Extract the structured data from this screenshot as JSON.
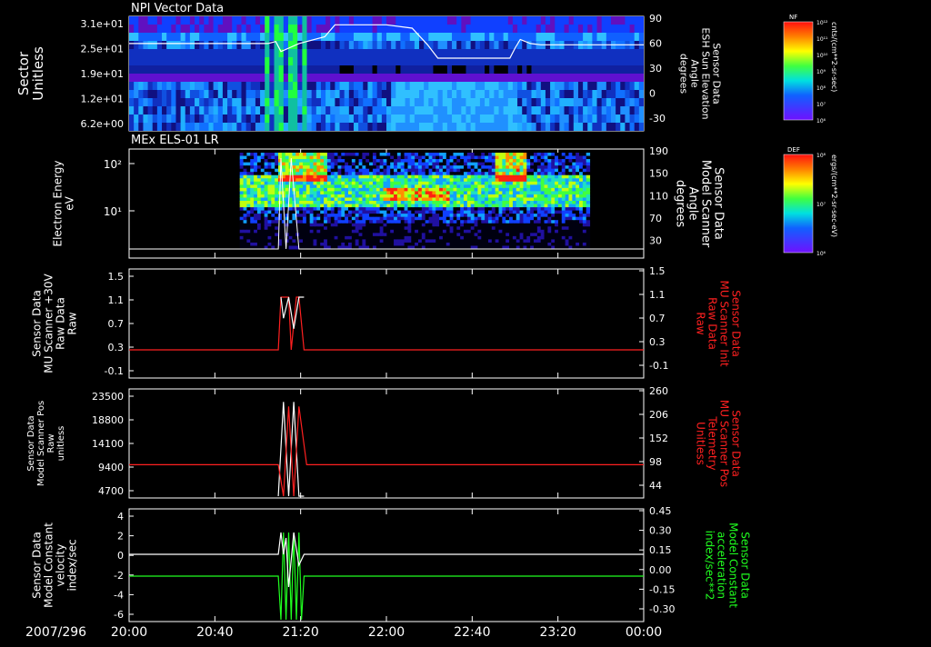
{
  "date": "2007/296",
  "time_ticks": [
    "20:00",
    "20:40",
    "21:20",
    "22:00",
    "22:40",
    "23:20",
    "00:00"
  ],
  "chart_data": [
    {
      "type": "heatmap",
      "title": "NPI Vector Data",
      "ylabel": [
        "Sector",
        "Unitless"
      ],
      "yticks": [
        "3.1e+01",
        "2.5e+01",
        "1.9e+01",
        "1.2e+01",
        "6.2e+00"
      ],
      "right_ylabel": [
        "Sensor Data",
        "ESH Sun Elevation",
        "Angle",
        "degrees"
      ],
      "right_ticks": [
        "90",
        "60",
        "30",
        "0",
        "-30"
      ],
      "right_ylim": [
        -60,
        90
      ],
      "overlay_line": {
        "x": [
          0.0,
          0.27,
          0.285,
          0.295,
          0.31,
          0.33,
          0.38,
          0.4,
          0.5,
          0.55,
          0.58,
          0.6,
          0.7,
          0.74,
          0.75,
          0.76,
          0.78,
          0.8,
          1.0
        ],
        "y": [
          52,
          52,
          55,
          40,
          45,
          52,
          62,
          80,
          80,
          75,
          50,
          30,
          30,
          30,
          45,
          58,
          52,
          50,
          50
        ]
      },
      "colorbar": {
        "label": "NF",
        "units": "cnts/(cm**2-sr-sec)",
        "ticks": [
          "10¹²",
          "10¹¹",
          "10¹⁰",
          "10⁹",
          "10⁸",
          "10⁷",
          "10⁶"
        ]
      }
    },
    {
      "type": "heatmap",
      "title": "MEx ELS-01 LR",
      "ylabel": [
        "Electron Energy",
        "eV"
      ],
      "yticks": [
        "10²",
        "10¹"
      ],
      "right_ylabel": [
        "Sensor Data",
        "Model Scanner",
        "Angle",
        "degrees"
      ],
      "right_ticks": [
        "190",
        "150",
        "110",
        "70",
        "30"
      ],
      "right_ylim": [
        10,
        190
      ],
      "colorbar": {
        "label": "DEF",
        "units": "ergs/(cm**2-sr-sec-eV)",
        "ticks": [
          "10⁸",
          "10⁷",
          "10⁶"
        ]
      }
    },
    {
      "type": "line",
      "ylabel": [
        "Sensor Data",
        "MU Scanner +30V",
        "Raw Data",
        "Raw"
      ],
      "ylim": [
        -0.5,
        1.5
      ],
      "yticks": [
        "1.5",
        "1.1",
        "0.7",
        "0.3",
        "-0.1"
      ],
      "right_ylabel": [
        "Sensor Data",
        "MU Scanner Init",
        "Raw Data",
        "Raw"
      ],
      "right_ticks": [
        "1.5",
        "1.1",
        "0.7",
        "0.3",
        "-0.1"
      ],
      "right_color": "#ff2020",
      "series": [
        {
          "color": "#ff2020",
          "x": [
            0.0,
            0.29,
            0.295,
            0.3,
            0.31,
            0.315,
            0.325,
            0.33,
            0.34,
            0.35,
            1.0
          ],
          "y": [
            0.0,
            0.0,
            1.0,
            1.0,
            1.0,
            0.0,
            1.0,
            1.0,
            0.0,
            0.0,
            0.0
          ]
        },
        {
          "color": "#ffffff",
          "x": [
            0.295,
            0.3,
            0.31,
            0.32,
            0.33,
            0.34
          ],
          "y": [
            1.0,
            0.6,
            1.0,
            0.4,
            1.0,
            1.0
          ]
        }
      ]
    },
    {
      "type": "line",
      "ylabel": [
        "Sensor Data",
        "Model Scanner Pos",
        "Raw",
        "unitless"
      ],
      "ylim": [
        0,
        23500
      ],
      "yticks": [
        "23500",
        "18800",
        "14100",
        "9400",
        "4700"
      ],
      "right_ylabel": [
        "Sensor Data",
        "MU Scanner Pos",
        "Telemetry",
        "Unitless"
      ],
      "right_ticks": [
        "260",
        "206",
        "152",
        "98",
        "44"
      ],
      "right_color": "#ff2020",
      "series": [
        {
          "color": "#ffffff",
          "x": [
            0.29,
            0.3,
            0.31,
            0.32,
            0.33,
            0.34
          ],
          "y": [
            0,
            21000,
            0,
            21000,
            0,
            0
          ]
        },
        {
          "color": "#ff2020",
          "x": [
            0.0,
            0.29,
            0.3,
            0.31,
            0.32,
            0.33,
            0.345,
            1.0
          ],
          "y": [
            7000,
            7000,
            0,
            20000,
            0,
            20000,
            7000,
            7000
          ]
        }
      ]
    },
    {
      "type": "line",
      "ylabel": [
        "Sensor Data",
        "Model Constant",
        "velocity",
        "index/sec"
      ],
      "ylim": [
        -6,
        4
      ],
      "yticks": [
        "4",
        "2",
        "0",
        "-2",
        "-4",
        "-6"
      ],
      "right_ylabel": [
        "Sensor Data",
        "Model Constant",
        "acceleration",
        "index/sec**2"
      ],
      "right_ticks": [
        "0.45",
        "0.30",
        "0.15",
        "0.00",
        "-0.15",
        "-0.30"
      ],
      "right_color": "#20ff20",
      "series": [
        {
          "color": "#20ff20",
          "x": [
            0.0,
            0.29,
            0.295,
            0.3,
            0.305,
            0.31,
            0.315,
            0.32,
            0.325,
            0.33,
            0.335,
            0.34,
            1.0
          ],
          "y": [
            -2,
            -2,
            -6,
            2,
            -6,
            2,
            -6,
            2,
            -6,
            2,
            -6,
            -2,
            -2
          ]
        },
        {
          "color": "#ffffff",
          "x": [
            0.0,
            0.29,
            0.295,
            0.3,
            0.305,
            0.31,
            0.32,
            0.33,
            0.34,
            1.0
          ],
          "y": [
            0,
            0,
            2,
            0,
            1.5,
            -3,
            2,
            -1,
            0,
            0
          ]
        }
      ]
    }
  ]
}
